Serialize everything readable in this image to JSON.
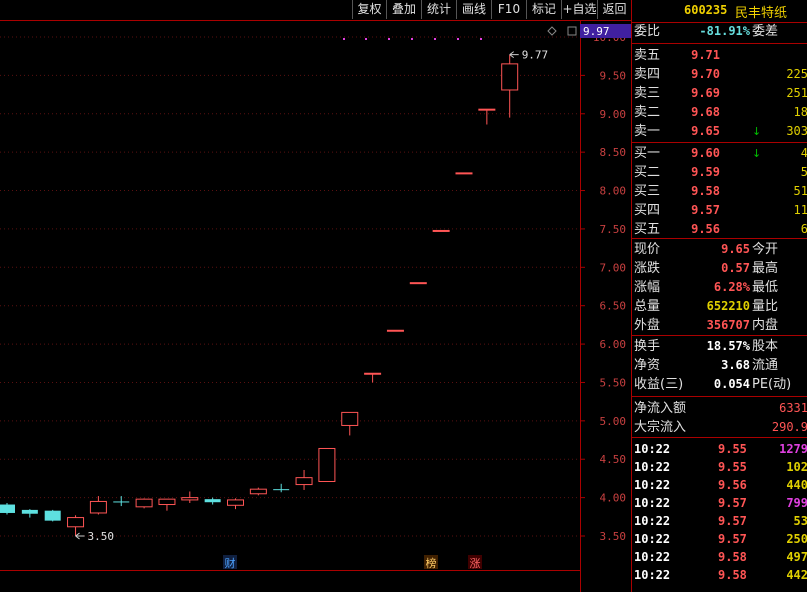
{
  "toolbar": {
    "buttons": [
      "复权",
      "叠加",
      "统计",
      "画线",
      "F10",
      "标记",
      "+自选",
      "返回"
    ]
  },
  "chart_data": {
    "type": "candlestick",
    "y_ticks": [
      "10.00",
      "9.50",
      "9.00",
      "8.50",
      "8.00",
      "7.50",
      "7.00",
      "6.50",
      "6.00",
      "5.50",
      "5.00",
      "4.50",
      "4.00",
      "3.50"
    ],
    "y_range": [
      3.2,
      10.3
    ],
    "current_price_label": "9.97",
    "high_annotation": "9.77",
    "low_annotation": "3.50",
    "markers": [
      {
        "text": "财",
        "color": "#4da3ff",
        "bg": "#102040"
      },
      {
        "text": "榜",
        "color": "#ffcc66",
        "bg": "#402000"
      },
      {
        "text": "涨",
        "color": "#ff6666",
        "bg": "#400000"
      }
    ],
    "candles": [
      {
        "o": 3.91,
        "c": 3.8,
        "h": 3.93,
        "l": 3.78,
        "color": "cyan"
      },
      {
        "o": 3.84,
        "c": 3.79,
        "h": 3.85,
        "l": 3.74,
        "color": "cyan"
      },
      {
        "o": 3.83,
        "c": 3.7,
        "h": 3.84,
        "l": 3.69,
        "color": "cyan"
      },
      {
        "o": 3.62,
        "c": 3.74,
        "h": 3.77,
        "l": 3.5,
        "color": "red"
      },
      {
        "o": 3.8,
        "c": 3.95,
        "h": 4.02,
        "l": 3.78,
        "color": "red"
      },
      {
        "o": 3.95,
        "c": 3.95,
        "h": 4.02,
        "l": 3.89,
        "color": "cyan"
      },
      {
        "o": 3.88,
        "c": 3.98,
        "h": 3.99,
        "l": 3.86,
        "color": "red"
      },
      {
        "o": 3.91,
        "c": 3.98,
        "h": 3.98,
        "l": 3.83,
        "color": "red"
      },
      {
        "o": 3.97,
        "c": 4.0,
        "h": 4.08,
        "l": 3.93,
        "color": "red"
      },
      {
        "o": 3.98,
        "c": 3.94,
        "h": 4.0,
        "l": 3.91,
        "color": "cyan"
      },
      {
        "o": 3.9,
        "c": 3.97,
        "h": 3.99,
        "l": 3.85,
        "color": "red"
      },
      {
        "o": 4.05,
        "c": 4.11,
        "h": 4.13,
        "l": 4.03,
        "color": "red"
      },
      {
        "o": 4.11,
        "c": 4.11,
        "h": 4.18,
        "l": 4.07,
        "color": "cyan"
      },
      {
        "o": 4.17,
        "c": 4.26,
        "h": 4.36,
        "l": 4.1,
        "color": "red"
      },
      {
        "o": 4.21,
        "c": 4.64,
        "h": 4.64,
        "l": 4.21,
        "color": "red"
      },
      {
        "o": 4.94,
        "c": 5.11,
        "h": 5.11,
        "l": 4.81,
        "color": "red"
      },
      {
        "o": 5.62,
        "c": 5.62,
        "h": 5.62,
        "l": 5.5,
        "color": "red"
      },
      {
        "o": 6.18,
        "c": 6.18,
        "h": 6.18,
        "l": 6.18,
        "color": "red"
      },
      {
        "o": 6.8,
        "c": 6.8,
        "h": 6.8,
        "l": 6.8,
        "color": "red"
      },
      {
        "o": 7.48,
        "c": 7.48,
        "h": 7.48,
        "l": 7.48,
        "color": "red"
      },
      {
        "o": 8.23,
        "c": 8.23,
        "h": 8.23,
        "l": 8.23,
        "color": "red"
      },
      {
        "o": 9.06,
        "c": 9.06,
        "h": 9.06,
        "l": 8.86,
        "color": "red"
      },
      {
        "o": 9.31,
        "c": 9.65,
        "h": 9.77,
        "l": 8.95,
        "color": "red"
      }
    ]
  },
  "quote": {
    "code": "600235",
    "name": "民丰特纸",
    "weibi_label": "委比",
    "weibi_value": "-81.91%",
    "weicha_label": "委差",
    "asks": [
      {
        "label": "卖五",
        "price": "9.71",
        "vol": "",
        "arrow": ""
      },
      {
        "label": "卖四",
        "price": "9.70",
        "vol": "225",
        "arrow": ""
      },
      {
        "label": "卖三",
        "price": "9.69",
        "vol": "251",
        "arrow": ""
      },
      {
        "label": "卖二",
        "price": "9.68",
        "vol": "18",
        "arrow": ""
      },
      {
        "label": "卖一",
        "price": "9.65",
        "vol": "303",
        "arrow": "↓"
      }
    ],
    "bids": [
      {
        "label": "买一",
        "price": "9.60",
        "vol": "4",
        "arrow": "↓"
      },
      {
        "label": "买二",
        "price": "9.59",
        "vol": "5",
        "arrow": ""
      },
      {
        "label": "买三",
        "price": "9.58",
        "vol": "51",
        "arrow": ""
      },
      {
        "label": "买四",
        "price": "9.57",
        "vol": "11",
        "arrow": ""
      },
      {
        "label": "买五",
        "price": "9.56",
        "vol": "6",
        "arrow": ""
      }
    ],
    "stats": [
      {
        "label": "现价",
        "value": "9.65",
        "cls": "red",
        "label2": "今开"
      },
      {
        "label": "涨跌",
        "value": "0.57",
        "cls": "red",
        "label2": "最高"
      },
      {
        "label": "涨幅",
        "value": "6.28%",
        "cls": "red",
        "label2": "最低"
      },
      {
        "label": "总量",
        "value": "652210",
        "cls": "yellow",
        "label2": "量比"
      },
      {
        "label": "外盘",
        "value": "356707",
        "cls": "red",
        "label2": "内盘"
      }
    ],
    "stats2": [
      {
        "label": "换手",
        "value": "18.57%",
        "cls": "white",
        "label2": "股本"
      },
      {
        "label": "净资",
        "value": "3.68",
        "cls": "white",
        "label2": "流通"
      },
      {
        "label": "收益(三)",
        "value": "0.054",
        "cls": "white",
        "label2": "PE(动)"
      }
    ],
    "flow": [
      {
        "label": "净流入额",
        "value": "6331"
      },
      {
        "label": "大宗流入",
        "value": "290.9"
      }
    ],
    "ticks": [
      {
        "time": "10:22",
        "price": "9.55",
        "vol": "1279",
        "cls": "mag"
      },
      {
        "time": "10:22",
        "price": "9.55",
        "vol": "102",
        "cls": "yellow"
      },
      {
        "time": "10:22",
        "price": "9.56",
        "vol": "440",
        "cls": "yellow"
      },
      {
        "time": "10:22",
        "price": "9.57",
        "vol": "799",
        "cls": "mag"
      },
      {
        "time": "10:22",
        "price": "9.57",
        "vol": "53",
        "cls": "yellow"
      },
      {
        "time": "10:22",
        "price": "9.57",
        "vol": "250",
        "cls": "yellow"
      },
      {
        "time": "10:22",
        "price": "9.58",
        "vol": "497",
        "cls": "yellow"
      },
      {
        "time": "10:22",
        "price": "9.58",
        "vol": "442",
        "cls": "yellow"
      }
    ]
  }
}
